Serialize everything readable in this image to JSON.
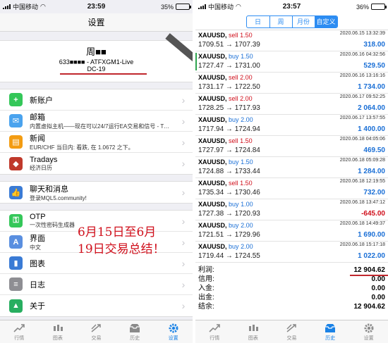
{
  "left": {
    "status": {
      "carrier": "中国移动",
      "time": "23:59",
      "battery": "35%",
      "battery_level": 0.35
    },
    "title": "设置",
    "account": {
      "name": "周■■",
      "number_line": "633■■■■ - ATFXGM1-Live",
      "server": "DC-19"
    },
    "group1": [
      {
        "title": "新账户",
        "sub": "",
        "icon": "add-account-icon",
        "color": "#34c759"
      },
      {
        "title": "邮箱",
        "sub": "内置虚拟主机——现在可以24/7运行EA交易和信号 - Tr…",
        "icon": "mail-icon",
        "color": "#4aa3ee"
      },
      {
        "title": "新闻",
        "sub": "EUR/CHF 当日内: 看跌, 在 1.0672 之下。",
        "icon": "news-icon",
        "color": "#f39c12"
      },
      {
        "title": "Tradays",
        "sub": "经济日历",
        "icon": "tradays-icon",
        "color": "#c0392b"
      }
    ],
    "group2": [
      {
        "title": "聊天和消息",
        "sub": "登录MQL5.community!",
        "icon": "chat-icon",
        "color": "#3a7bd5"
      }
    ],
    "group3": [
      {
        "title": "OTP",
        "sub": "一次性密码生成器",
        "icon": "otp-icon",
        "color": "#34c759"
      },
      {
        "title": "界面",
        "sub": "中文",
        "icon": "language-icon",
        "color": "#5a8fe0"
      },
      {
        "title": "图表",
        "sub": "",
        "icon": "chart-icon",
        "color": "#3a7bd5"
      },
      {
        "title": "日志",
        "sub": "",
        "icon": "journal-icon",
        "color": "#8e8e93"
      },
      {
        "title": "关于",
        "sub": "",
        "icon": "about-icon",
        "color": "#27ae60"
      }
    ],
    "overlay": [
      "6月15日至6月",
      "19日交易总结！"
    ],
    "tabs": [
      {
        "label": "行情",
        "icon": "quotes-icon",
        "active": false
      },
      {
        "label": "图表",
        "icon": "chart-tab-icon",
        "active": false
      },
      {
        "label": "交易",
        "icon": "trade-icon",
        "active": false
      },
      {
        "label": "历史",
        "icon": "history-icon",
        "active": false
      },
      {
        "label": "设置",
        "icon": "settings-icon",
        "active": true
      }
    ]
  },
  "right": {
    "status": {
      "carrier": "中国移动",
      "time": "23:57",
      "battery": "36%",
      "battery_level": 0.36
    },
    "segments": [
      {
        "label": "日",
        "active": false
      },
      {
        "label": "周",
        "active": false
      },
      {
        "label": "月份",
        "active": false
      },
      {
        "label": "自定义",
        "active": true
      }
    ],
    "deals": [
      {
        "symbol": "XAUUSD,",
        "side": "sell",
        "lots": "1.50",
        "date": "2020.06.15 13:32:39",
        "prices": "1709.51 → 1707.39",
        "profit": "318.00"
      },
      {
        "symbol": "XAUUSD,",
        "side": "buy",
        "lots": "1.50",
        "date": "2020.06.16 04:32:56",
        "prices": "1727.47 → 1731.00",
        "profit": "529.50"
      },
      {
        "symbol": "XAUUSD,",
        "side": "sell",
        "lots": "2.00",
        "date": "2020.06.16 13:16:16",
        "prices": "1731.17 → 1722.50",
        "profit": "1 734.00"
      },
      {
        "symbol": "XAUUSD,",
        "side": "sell",
        "lots": "2.00",
        "date": "2020.06.17 09:52:25",
        "prices": "1728.25 → 1717.93",
        "profit": "2 064.00"
      },
      {
        "symbol": "XAUUSD,",
        "side": "buy",
        "lots": "2.00",
        "date": "2020.06.17 13:57:55",
        "prices": "1717.94 → 1724.94",
        "profit": "1 400.00"
      },
      {
        "symbol": "XAUUSD,",
        "side": "sell",
        "lots": "1.50",
        "date": "2020.06.18 04:05:06",
        "prices": "1727.97 → 1724.84",
        "profit": "469.50"
      },
      {
        "symbol": "XAUUSD,",
        "side": "buy",
        "lots": "1.50",
        "date": "2020.06.18 05:09:28",
        "prices": "1724.88 → 1733.44",
        "profit": "1 284.00"
      },
      {
        "symbol": "XAUUSD,",
        "side": "sell",
        "lots": "1.50",
        "date": "2020.06.18 12:19:55",
        "prices": "1735.34 → 1730.46",
        "profit": "732.00"
      },
      {
        "symbol": "XAUUSD,",
        "side": "buy",
        "lots": "1.00",
        "date": "2020.06.18 13:47:12",
        "prices": "1727.38 → 1720.93",
        "profit": "-645.00"
      },
      {
        "symbol": "XAUUSD,",
        "side": "buy",
        "lots": "2.00",
        "date": "2020.06.18 14:49:37",
        "prices": "1721.51 → 1729.96",
        "profit": "1 690.00"
      },
      {
        "symbol": "XAUUSD,",
        "side": "buy",
        "lots": "2.00",
        "date": "2020.06.18 15:17:18",
        "prices": "1719.44 → 1724.55",
        "profit": "1 022.00"
      }
    ],
    "summary": [
      {
        "label": "利润:",
        "value": "12 904.62"
      },
      {
        "label": "信用:",
        "value": "0.00"
      },
      {
        "label": "入金:",
        "value": "0.00"
      },
      {
        "label": "出金:",
        "value": "0.00"
      },
      {
        "label": "结余:",
        "value": "12 904.62"
      }
    ],
    "tabs": [
      {
        "label": "行情",
        "icon": "quotes-icon",
        "active": false
      },
      {
        "label": "图表",
        "icon": "chart-tab-icon",
        "active": false
      },
      {
        "label": "交易",
        "icon": "trade-icon",
        "active": false
      },
      {
        "label": "历史",
        "icon": "history-icon",
        "active": true
      },
      {
        "label": "设置",
        "icon": "settings-icon",
        "active": false
      }
    ]
  }
}
